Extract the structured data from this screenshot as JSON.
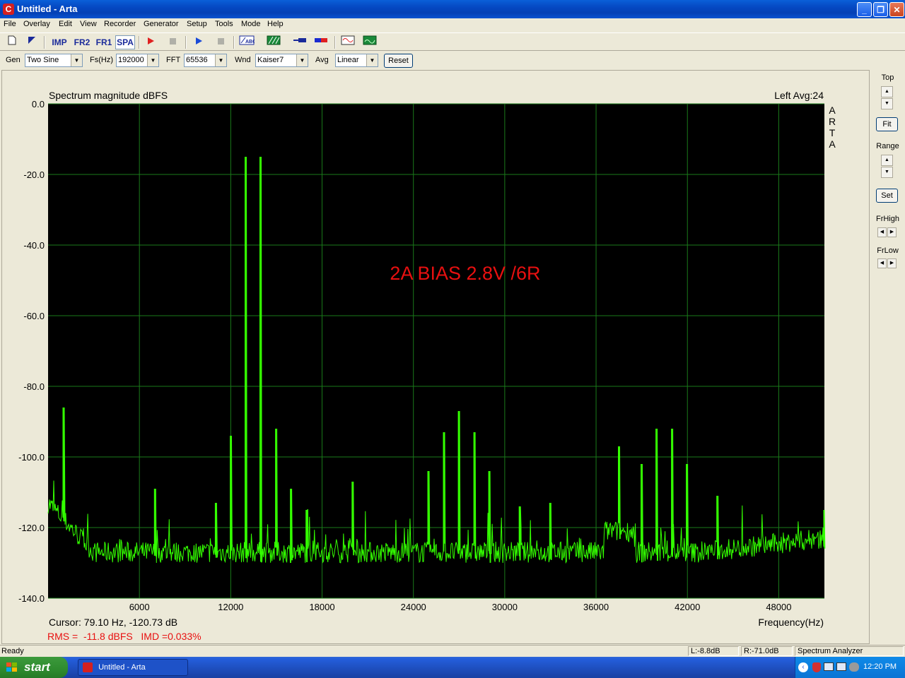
{
  "window": {
    "title": "Untitled - Arta",
    "app_icon": "C"
  },
  "menu": [
    "File",
    "Overlay",
    "Edit",
    "View",
    "Recorder",
    "Generator",
    "Setup",
    "Tools",
    "Mode",
    "Help"
  ],
  "toolbar": {
    "imp_label": "IMP",
    "fr2_label": "FR2",
    "fr1_label": "FR1",
    "spa_label": "SPA"
  },
  "settings": {
    "gen_label": "Gen",
    "gen_value": "Two Sine",
    "fs_label": "Fs(Hz)",
    "fs_value": "192000",
    "fft_label": "FFT",
    "fft_value": "65536",
    "wnd_label": "Wnd",
    "wnd_value": "Kaiser7",
    "avg_label": "Avg",
    "avg_value": "Linear",
    "reset_label": "Reset"
  },
  "right_panel": {
    "top_label": "Top",
    "fit_label": "Fit",
    "range_label": "Range",
    "set_label": "Set",
    "frhigh_label": "FrHigh",
    "frlow_label": "FrLow"
  },
  "plot": {
    "cursor_text": "Cursor: 79.10 Hz, -120.73 dB",
    "rms_text": "RMS =  -11.8 dBFS   IMD =0.033%",
    "annotation": "2A BIAS 2.8V /6R",
    "channel_text": "Left  Avg:24",
    "watermark": [
      "A",
      "R",
      "T",
      "A"
    ]
  },
  "chart_data": {
    "type": "line",
    "title": "Spectrum magnitude dBFS",
    "xlabel": "Frequency(Hz)",
    "ylabel": "",
    "xlim": [
      0,
      51000
    ],
    "ylim": [
      -140,
      0
    ],
    "xticks": [
      6000,
      12000,
      18000,
      24000,
      30000,
      36000,
      42000,
      48000
    ],
    "yticks": [
      0,
      -20,
      -40,
      -60,
      -80,
      -100,
      -120,
      -140
    ],
    "ytick_labels": [
      "0.0",
      "-20.0",
      "-40.0",
      "-60.0",
      "-80.0",
      "-100.0",
      "-120.0",
      "-140.0"
    ],
    "grid": true,
    "line_color": "#33ff00",
    "background": "#000000",
    "grid_color": "#1a7a1a",
    "noise_floor_db": -127,
    "peaks": [
      {
        "f": 13000,
        "db": -15
      },
      {
        "f": 14000,
        "db": -15
      },
      {
        "f": 1000,
        "db": -86
      },
      {
        "f": 12000,
        "db": -94
      },
      {
        "f": 15000,
        "db": -92
      },
      {
        "f": 7000,
        "db": -109
      },
      {
        "f": 16000,
        "db": -109
      },
      {
        "f": 20000,
        "db": -107
      },
      {
        "f": 26000,
        "db": -93
      },
      {
        "f": 27000,
        "db": -87
      },
      {
        "f": 28000,
        "db": -93
      },
      {
        "f": 25000,
        "db": -104
      },
      {
        "f": 29000,
        "db": -104
      },
      {
        "f": 37500,
        "db": -97
      },
      {
        "f": 39000,
        "db": -102
      },
      {
        "f": 40000,
        "db": -92
      },
      {
        "f": 41000,
        "db": -92
      },
      {
        "f": 42000,
        "db": -102
      },
      {
        "f": 11000,
        "db": -113
      },
      {
        "f": 17000,
        "db": -115
      },
      {
        "f": 31000,
        "db": -114
      },
      {
        "f": 33000,
        "db": -113
      },
      {
        "f": 44000,
        "db": -111
      },
      {
        "f": 51000,
        "db": -115
      }
    ]
  },
  "status": {
    "ready": "Ready",
    "left_level": "L:-8.8dB",
    "right_level": "R:-71.0dB",
    "mode": "Spectrum Analyzer"
  },
  "taskbar": {
    "start_label": "start",
    "task_label": "Untitled - Arta",
    "clock": "12:20 PM"
  }
}
